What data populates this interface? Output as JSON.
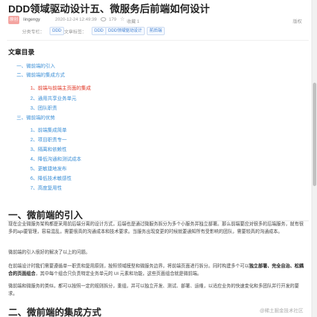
{
  "article": {
    "title": "DDD领域驱动设计五、微服务后前端如何设计",
    "meta": {
      "badge": "原创",
      "author": "lingengy",
      "date": "2020-12-24 12:49:39",
      "views": "179",
      "favorites": "收藏 1",
      "edit": "版权"
    },
    "tags": {
      "category_label": "分类专栏：",
      "category": "DDD",
      "tag_label": "文章标签：",
      "tags": [
        "DDD",
        "DDD领域驱动设计",
        "前后端"
      ]
    }
  },
  "toc": {
    "title": "文章目录",
    "items": [
      "一、微前端的引入",
      "二、微前端的集成方式",
      "1、前端与前端主页面的集成",
      "2、通用共享业务单元",
      "3、团队职责",
      "三、微前端的优势",
      "1、前端集成简单",
      "2、项目职责专一",
      "3、隔离和依赖性",
      "4、降低沟通和测试成本",
      "5、更敏捷地发布",
      "6、降低技术敏感性",
      "7、高度复用性"
    ]
  },
  "content": {
    "section1_title": "一、微前端的引入",
    "p1": "现在企业微服务架构都是采用前后端分离的设计方式，后端也是通过微服务拆分为多个小服务并独立部署。那么前端要应对很多的后端服务，就有很多的api要管理，容易混乱，需要很高的沟通成本和技术要求。当服务出现变更的时候就要通知所有受影响的团队，需要较高的沟通成本。",
    "p2": "微前端的引入很好的解决了以上的问题。",
    "p3_a": "在前端设计时我们需要遵循单一职责和复用原则，按照领域模型和微服务边界，将前端页面进行拆分。同时构建多个可以",
    "p3_b": "独立部署、完全自治、松耦合的页面组合",
    "p3_c": "，其中每个组合只负责特定业务单元的 UI 元素和功能，这些页面组合就是微前端。",
    "p4": "微前端和微服务的类似，都可以按照一定的规则拆分，重组，并可以独立开发、测试、部署、运维，以适应业务的快速变化和多团队并行开发的要求。",
    "section2_title": "二、微前端的集成方式"
  },
  "watermark": "@稀土掘金技术社区"
}
